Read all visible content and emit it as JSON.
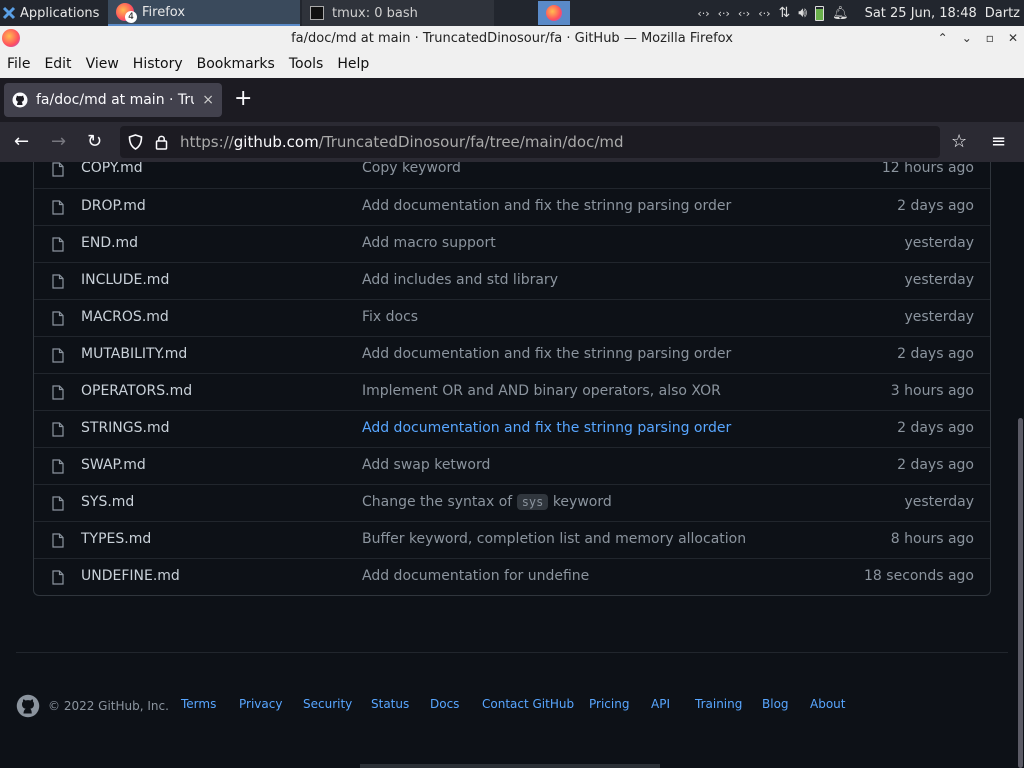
{
  "taskbar": {
    "apps_label": "Applications",
    "tasks": [
      {
        "label": "Firefox",
        "badge": "4",
        "active": true
      },
      {
        "label": "tmux: 0 bash",
        "active": false
      }
    ],
    "clock": "Sat 25 Jun, 18:48",
    "user": "Dartz"
  },
  "window": {
    "title": "fa/doc/md at main · TruncatedDinosour/fa · GitHub — Mozilla Firefox"
  },
  "menu": {
    "file": "File",
    "edit": "Edit",
    "view": "View",
    "history": "History",
    "bookmarks": "Bookmarks",
    "tools": "Tools",
    "help": "Help"
  },
  "tab": {
    "title": "fa/doc/md at main · TruncatedDinosour/fa",
    "close": "×",
    "new": "+"
  },
  "nav": {
    "url_prefix": "https://",
    "url_host": "github.com",
    "url_path": "/TruncatedDinosour/fa/tree/main/doc/md"
  },
  "files": [
    {
      "name": "COPY.md",
      "message": "Copy keyword",
      "age": "12 hours ago"
    },
    {
      "name": "DROP.md",
      "message": "Add documentation and fix the strinng parsing order",
      "age": "2 days ago"
    },
    {
      "name": "END.md",
      "message": "Add macro support",
      "age": "yesterday"
    },
    {
      "name": "INCLUDE.md",
      "message": "Add includes and std library",
      "age": "yesterday"
    },
    {
      "name": "MACROS.md",
      "message": "Fix docs",
      "age": "yesterday"
    },
    {
      "name": "MUTABILITY.md",
      "message": "Add documentation and fix the strinng parsing order",
      "age": "2 days ago"
    },
    {
      "name": "OPERATORS.md",
      "message": "Implement OR and AND binary operators, also XOR",
      "age": "3 hours ago"
    },
    {
      "name": "STRINGS.md",
      "message": "Add documentation and fix the strinng parsing order",
      "age": "2 days ago",
      "hover": true
    },
    {
      "name": "SWAP.md",
      "message": "Add swap ketword",
      "age": "2 days ago"
    },
    {
      "name": "SYS.md",
      "message_before": "Change the syntax of",
      "message_code": "sys",
      "message_after": "keyword",
      "age": "yesterday"
    },
    {
      "name": "TYPES.md",
      "message": "Buffer keyword, completion list and memory allocation",
      "age": "8 hours ago"
    },
    {
      "name": "UNDEFINE.md",
      "message": "Add documentation for undefine",
      "age": "18 seconds ago"
    }
  ],
  "footer": {
    "copyright": "© 2022 GitHub, Inc.",
    "links": [
      "Terms",
      "Privacy",
      "Security",
      "Status",
      "Docs",
      "Contact GitHub",
      "Pricing",
      "API",
      "Training",
      "Blog",
      "About"
    ]
  },
  "colors": {
    "background": "#0d1117",
    "link": "#58a6ff",
    "muted": "#8b949e",
    "text": "#c9d1d9"
  }
}
